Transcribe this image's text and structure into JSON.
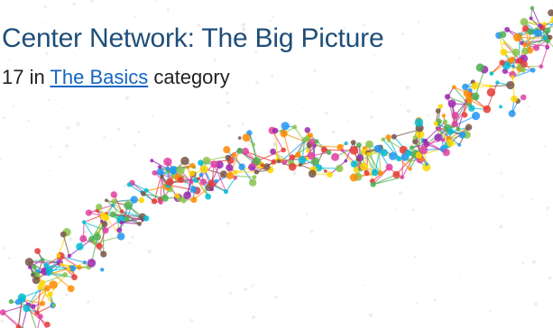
{
  "post": {
    "title": "Center Network: The Big Picture",
    "meta_prefix": "17 in ",
    "category_link": "The Basics",
    "meta_suffix": " category"
  },
  "colors": {
    "title": "#1f4e79",
    "link": "#1565c0",
    "text": "#222222",
    "background": "#ffffff",
    "molecule_palette": [
      "#e040a0",
      "#ff8a00",
      "#ffd600",
      "#4caf50",
      "#00bcd4",
      "#2196f3",
      "#9c27b0",
      "#e53935",
      "#8bc34a",
      "#795548"
    ]
  },
  "decoration": {
    "icon": "molecule-network-illustration"
  }
}
